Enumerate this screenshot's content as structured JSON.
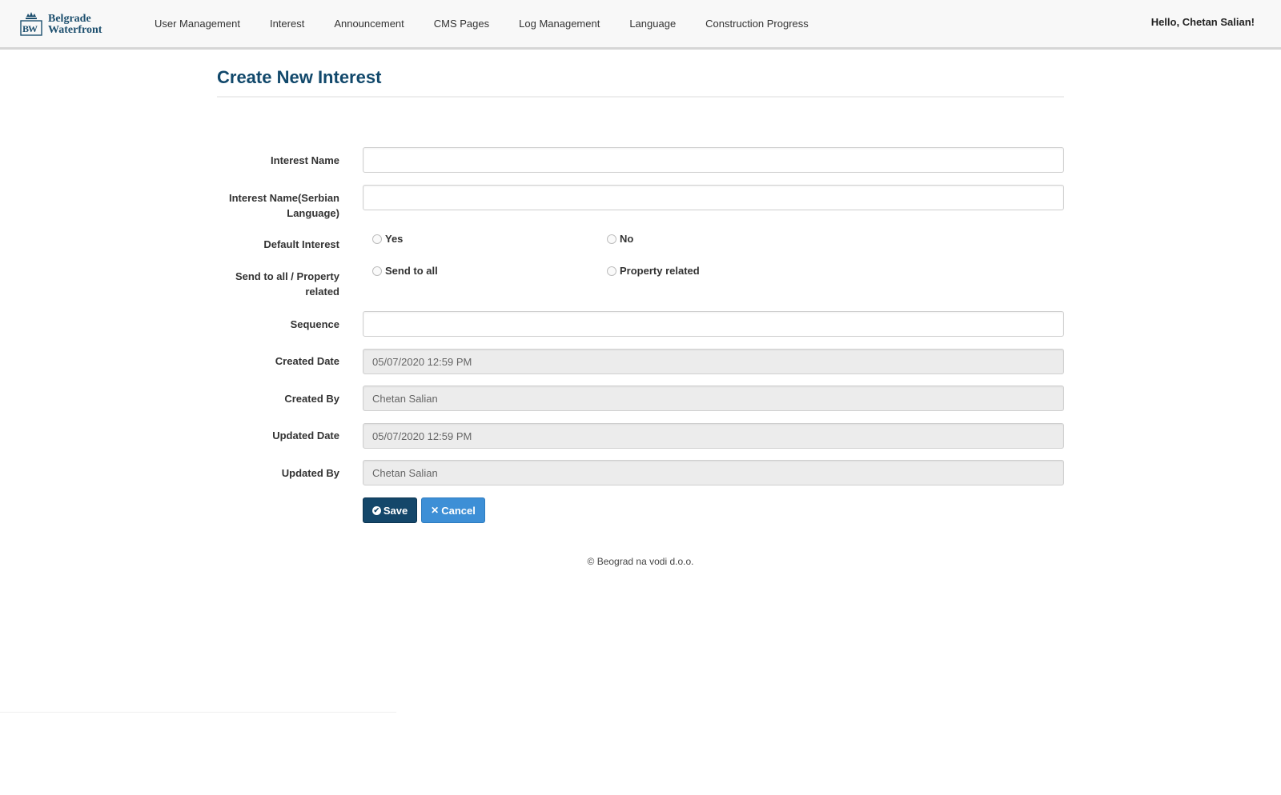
{
  "brand": {
    "line1": "Belgrade",
    "line2": "Waterfront",
    "monogram": "BW",
    "icon": "crown-logo-icon"
  },
  "nav": {
    "items": [
      {
        "label": "User Management"
      },
      {
        "label": "Interest"
      },
      {
        "label": "Announcement"
      },
      {
        "label": "CMS Pages"
      },
      {
        "label": "Log Management"
      },
      {
        "label": "Language"
      },
      {
        "label": "Construction Progress"
      }
    ],
    "user_greeting": "Hello, Chetan Salian!"
  },
  "page": {
    "title": "Create New Interest"
  },
  "form": {
    "interest_name": {
      "label": "Interest Name",
      "value": ""
    },
    "interest_name_serbian": {
      "label": "Interest Name(Serbian Language)",
      "value": ""
    },
    "default_interest": {
      "label": "Default Interest",
      "options": [
        {
          "label": "Yes",
          "checked": false
        },
        {
          "label": "No",
          "checked": false
        }
      ]
    },
    "send_to": {
      "label": "Send to all / Property related",
      "options": [
        {
          "label": "Send to all",
          "checked": false
        },
        {
          "label": "Property related",
          "checked": false
        }
      ]
    },
    "sequence": {
      "label": "Sequence",
      "value": ""
    },
    "created_date": {
      "label": "Created Date",
      "value": "05/07/2020 12:59 PM"
    },
    "created_by": {
      "label": "Created By",
      "value": "Chetan Salian"
    },
    "updated_date": {
      "label": "Updated Date",
      "value": "05/07/2020 12:59 PM"
    },
    "updated_by": {
      "label": "Updated By",
      "value": "Chetan Salian"
    }
  },
  "actions": {
    "save_label": "Save",
    "cancel_label": "Cancel"
  },
  "footer": {
    "copyright": "© Beograd na vodi d.o.o."
  },
  "colors": {
    "brand_navy": "#14476a",
    "title_blue": "#11486b",
    "cancel_blue": "#3d8fd6",
    "readonly_bg": "#ececec"
  }
}
